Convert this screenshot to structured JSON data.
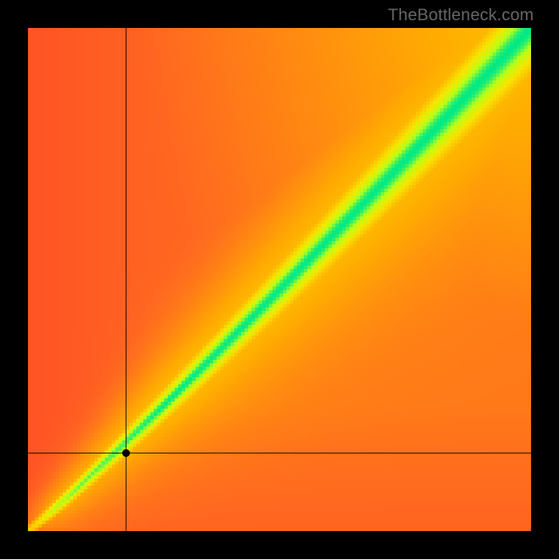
{
  "watermark": "TheBottleneck.com",
  "chart_data": {
    "type": "heatmap",
    "title": "",
    "xlabel": "",
    "ylabel": "",
    "x_range": [
      0,
      1
    ],
    "y_range": [
      0,
      1
    ],
    "crosshair": {
      "x": 0.195,
      "y": 0.155
    },
    "marker": {
      "x": 0.195,
      "y": 0.155
    },
    "color_scale": {
      "stops": [
        {
          "t": 0.0,
          "color": "#ff292f"
        },
        {
          "t": 0.3,
          "color": "#ff6a20"
        },
        {
          "t": 0.55,
          "color": "#ffb000"
        },
        {
          "t": 0.78,
          "color": "#f7e600"
        },
        {
          "t": 0.92,
          "color": "#b7ff19"
        },
        {
          "t": 1.0,
          "color": "#00e987"
        }
      ]
    },
    "optimal_band_description": "Green diagonal band widening toward upper-right; background gradient red→yellow with axis proximity",
    "grid": false,
    "resolution": 144
  }
}
